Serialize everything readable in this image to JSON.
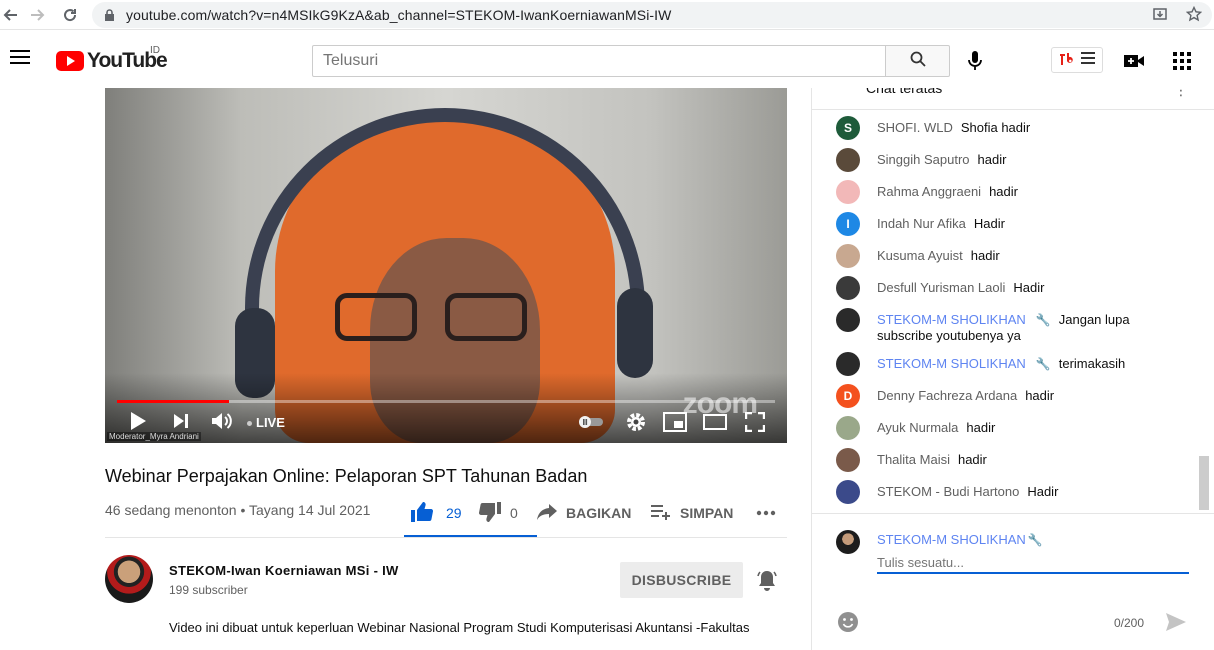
{
  "browser": {
    "url": "youtube.com/watch?v=n4MSIkG9KzA&ab_channel=STEKOM-IwanKoerniawanMSi-IW"
  },
  "header": {
    "logo_text": "YouTube",
    "country_code": "ID",
    "search_placeholder": "Telusuri",
    "accent_color": "#ff0000"
  },
  "video": {
    "title": "Webinar Perpajakan Online: Pelaporan SPT Tahunan Badan",
    "viewers": "46 sedang menonton",
    "separator": "•",
    "premiere_date": "Tayang 14 Jul 2021",
    "live_label": "LIVE",
    "watermark": "zoom",
    "moderator_label": "Moderator_Myra Andriani",
    "progress_fraction": 0.17
  },
  "actions": {
    "like_count": "29",
    "dislike_count": "0",
    "share_label": "BAGIKAN",
    "save_label": "SIMPAN"
  },
  "channel": {
    "name": "STEKOM-Iwan Koerniawan MSi - IW",
    "subscribers": "199 subscriber",
    "unsubscribe_label": "DISBUSCRIBE",
    "description": "Video ini dibuat untuk keperluan Webinar Nasional Program Studi Komputerisasi Akuntansi -Fakultas"
  },
  "chat": {
    "title": "Chat teratas",
    "messages": [
      {
        "author": "SHOFI. WLD",
        "text": "Shofia hadir",
        "avatar_letter": "S",
        "avatar_color": "#1e5b3a",
        "moderator": false
      },
      {
        "author": "Singgih Saputro",
        "text": "hadir",
        "avatar_color": "#5a4a3a",
        "moderator": false
      },
      {
        "author": "Rahma Anggraeni",
        "text": "hadir",
        "avatar_color": "#f2b8b8",
        "moderator": false
      },
      {
        "author": "Indah Nur Afika",
        "text": "Hadir",
        "avatar_letter": "I",
        "avatar_color": "#1e88e5",
        "moderator": false
      },
      {
        "author": "Kusuma Ayuist",
        "text": "hadir",
        "avatar_color": "#c8a890",
        "moderator": false
      },
      {
        "author": "Desfull Yurisman Laoli",
        "text": "Hadir",
        "avatar_color": "#3a3a3a",
        "moderator": false
      },
      {
        "author": "STEKOM-M SHOLIKHAN",
        "text": "Jangan lupa subscribe youtubenya ya",
        "avatar_color": "#2a2a2a",
        "moderator": true
      },
      {
        "author": "STEKOM-M SHOLIKHAN",
        "text": "terimakasih",
        "avatar_color": "#2a2a2a",
        "moderator": true
      },
      {
        "author": "Denny Fachreza Ardana",
        "text": "hadir",
        "avatar_letter": "D",
        "avatar_color": "#f4511e",
        "moderator": false
      },
      {
        "author": "Ayuk Nurmala",
        "text": "hadir",
        "avatar_color": "#9aa88a",
        "moderator": false
      },
      {
        "author": "Thalita Maisi",
        "text": "hadir",
        "avatar_color": "#7a5a4a",
        "moderator": false
      },
      {
        "author": "STEKOM - Budi Hartono",
        "text": "Hadir",
        "avatar_color": "#3b4a8a",
        "moderator": false
      }
    ],
    "input": {
      "user_name": "STEKOM-M SHOLIKHAN",
      "placeholder": "Tulis sesuatu...",
      "char_count": "0/200"
    }
  }
}
